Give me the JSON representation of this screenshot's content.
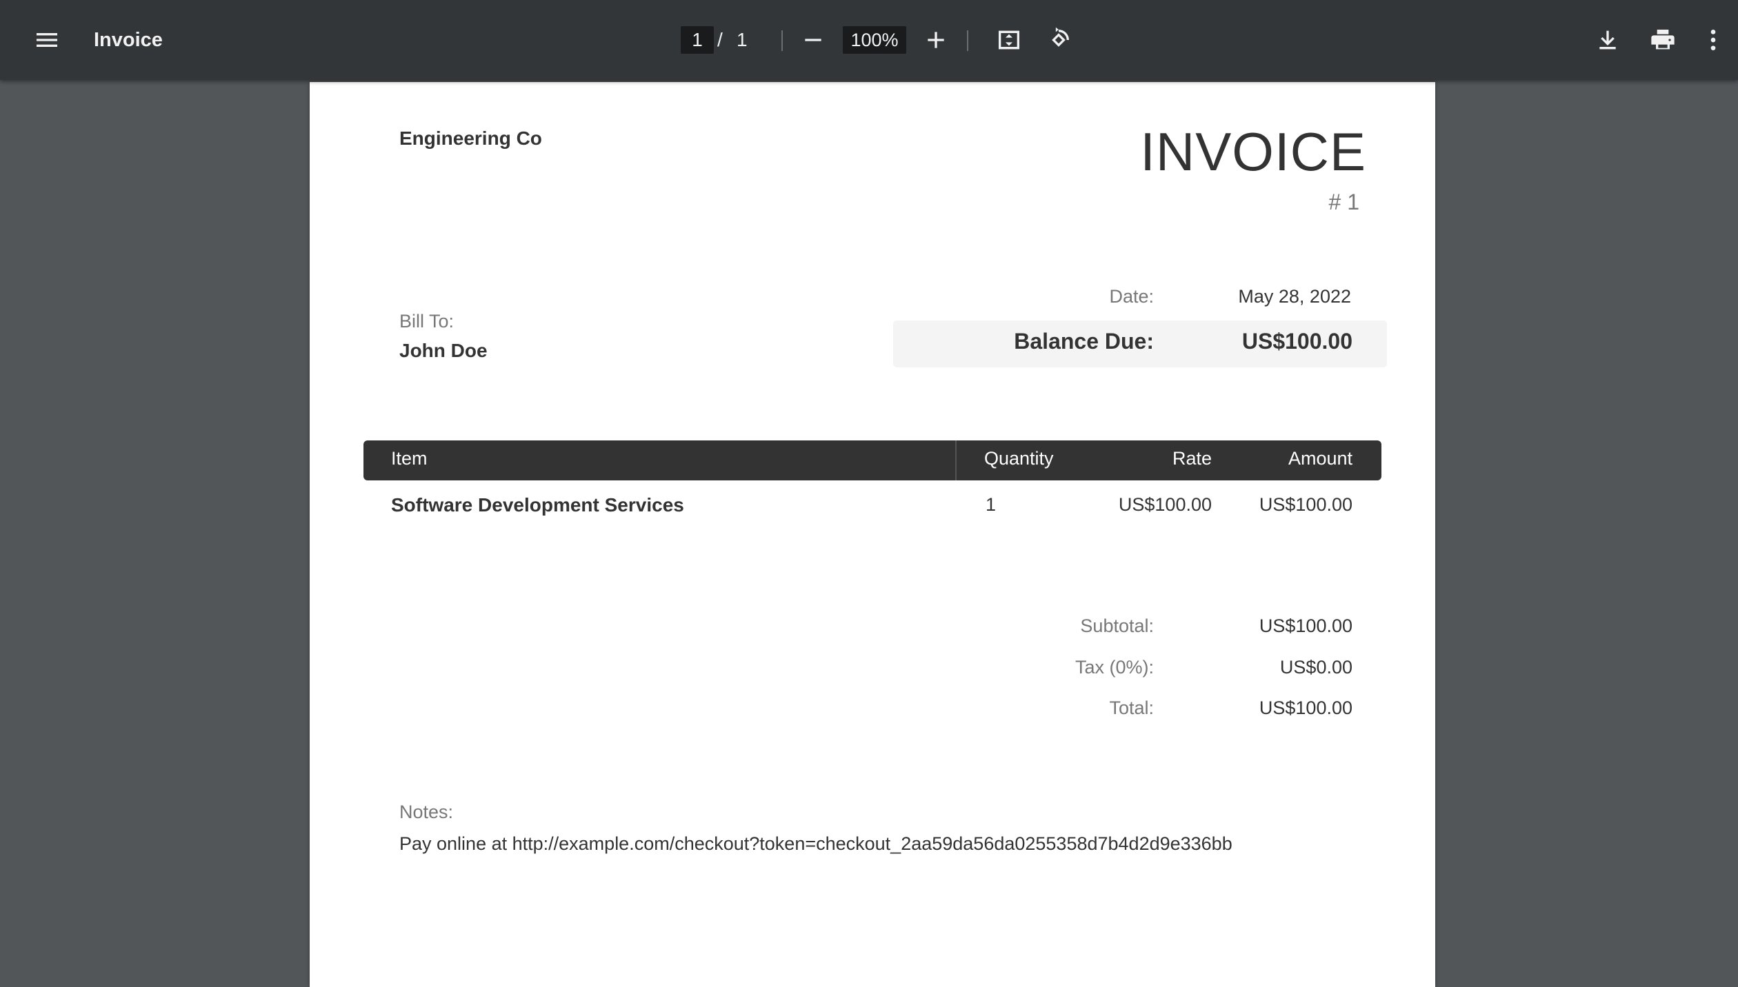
{
  "toolbar": {
    "title": "Invoice",
    "page_current": "1",
    "page_separator": "/",
    "page_total": "1",
    "zoom": "100%"
  },
  "invoice": {
    "company": "Engineering Co",
    "title": "INVOICE",
    "number": "# 1",
    "date_label": "Date:",
    "date_value": "May 28, 2022",
    "balance_label": "Balance Due:",
    "balance_value": "US$100.00",
    "bill_to_label": "Bill To:",
    "bill_to_name": "John Doe",
    "table": {
      "headers": [
        "Item",
        "Quantity",
        "Rate",
        "Amount"
      ],
      "rows": [
        {
          "item": "Software Development Services",
          "quantity": "1",
          "rate": "US$100.00",
          "amount": "US$100.00"
        }
      ]
    },
    "totals": [
      {
        "label": "Subtotal:",
        "value": "US$100.00"
      },
      {
        "label": "Tax (0%):",
        "value": "US$0.00"
      },
      {
        "label": "Total:",
        "value": "US$100.00"
      }
    ],
    "notes_label": "Notes:",
    "notes_text": "Pay online at http://example.com/checkout?token=checkout_2aa59da56da0255358d7b4d2d9e336bb"
  },
  "icons": {
    "menu": "menu-icon",
    "zoom_out": "minus-icon",
    "zoom_in": "plus-icon",
    "fit": "fit-page-icon",
    "rotate": "rotate-icon",
    "download": "download-icon",
    "print": "print-icon",
    "more": "more-vert-icon"
  },
  "colors": {
    "toolbar_bg": "#323639",
    "viewer_bg": "#525659",
    "table_header_bg": "#333333",
    "balance_bg": "#f4f4f4"
  }
}
